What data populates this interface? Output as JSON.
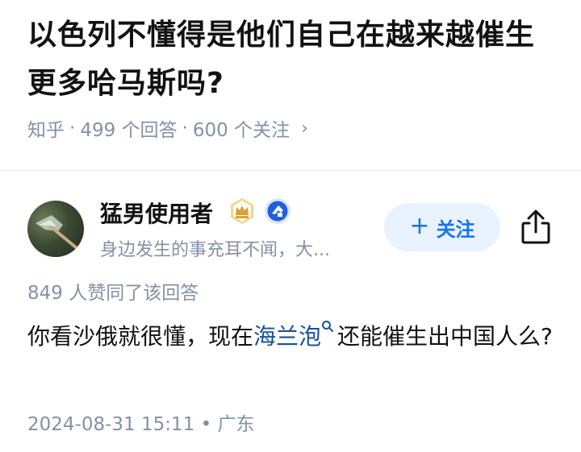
{
  "question": {
    "title": "以色列不懂得是他们自己在越来越催生更多哈马斯吗?",
    "meta": {
      "source": "知乎",
      "answers": "499 个回答",
      "followers": "600 个关注",
      "separator": "·",
      "chevron": "›"
    }
  },
  "author": {
    "name": "猛男使用者",
    "bio": "身边发生的事充耳不闻，大...",
    "follow_label": "关注",
    "follow_plus": "+",
    "badges": [
      "crown-badge-icon",
      "blue-verified-icon"
    ]
  },
  "answer": {
    "likes": "849 人赞同了该回答",
    "text_before": "你看沙俄就很懂，现在",
    "link_text": "海兰泡",
    "text_after": "还能催生出中国人么?",
    "timestamp": "2024-08-31 15:11",
    "dot": "•",
    "location": "广东"
  },
  "colors": {
    "link": "#175199",
    "accent": "#1772f6",
    "meta": "#8590a6"
  }
}
